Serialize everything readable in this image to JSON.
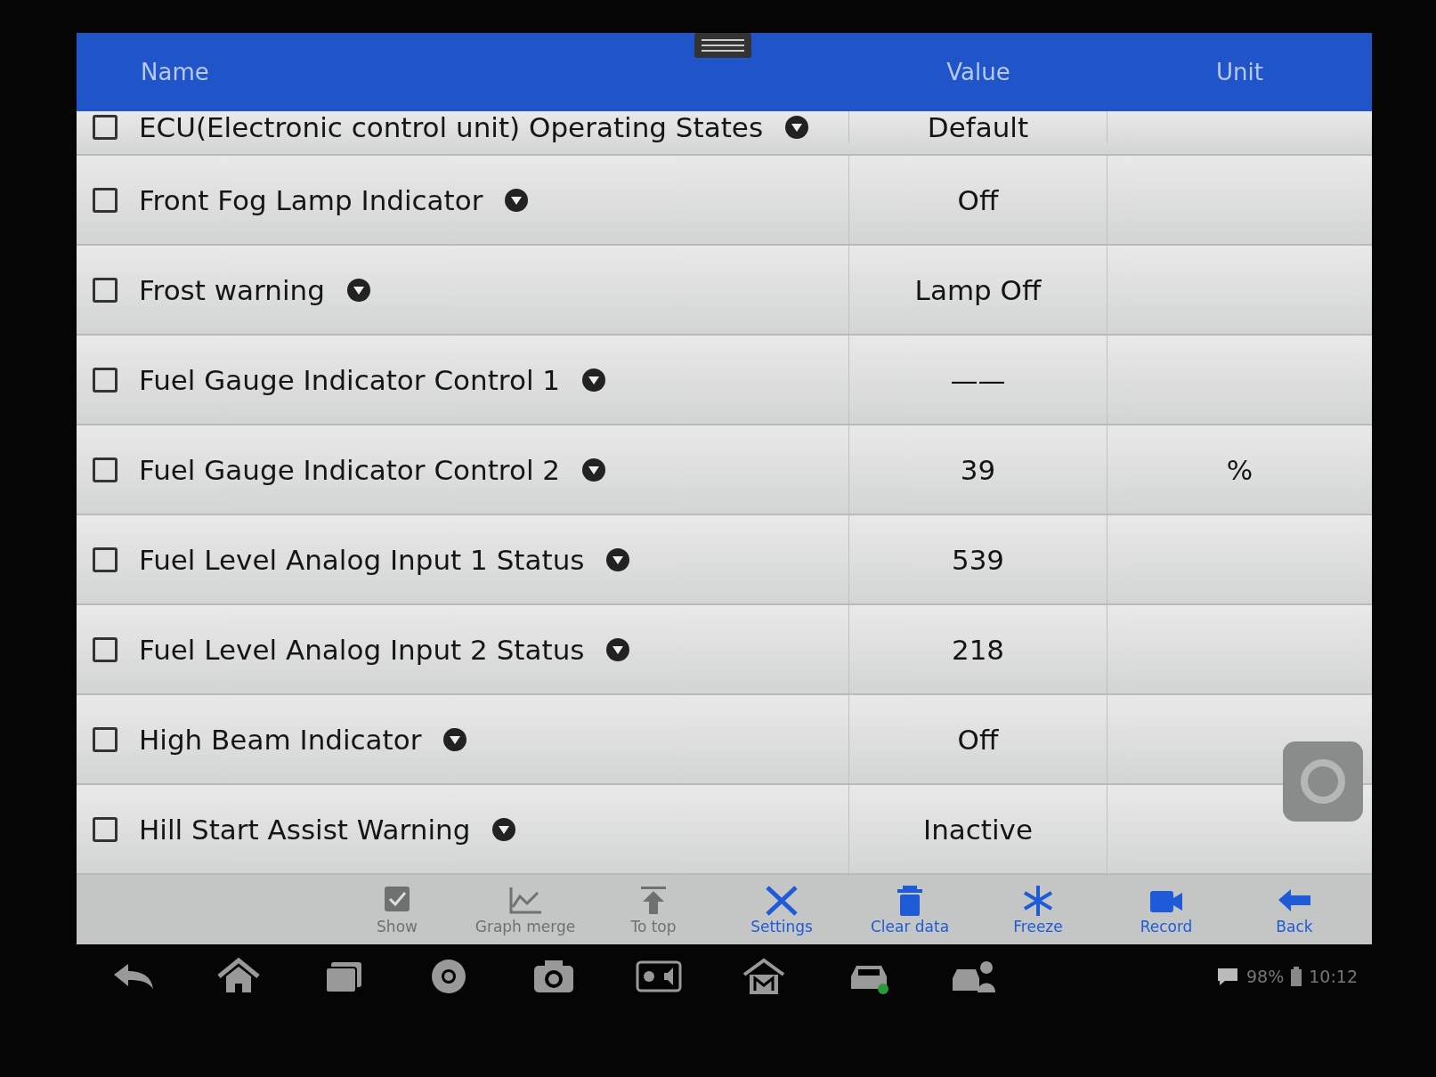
{
  "header": {
    "name": "Name",
    "value": "Value",
    "unit": "Unit"
  },
  "rows": [
    {
      "name": "ECU(Electronic control unit) Operating States",
      "value": "Default",
      "unit": "",
      "checked": false,
      "kind": "partial"
    },
    {
      "name": "Front Fog Lamp Indicator",
      "value": "Off",
      "unit": "",
      "checked": false,
      "kind": "full"
    },
    {
      "name": "Frost warning",
      "value": "Lamp Off",
      "unit": "",
      "checked": false,
      "kind": "full"
    },
    {
      "name": "Fuel Gauge Indicator Control 1",
      "value": "——",
      "unit": "",
      "checked": false,
      "kind": "full"
    },
    {
      "name": "Fuel Gauge Indicator Control 2",
      "value": "39",
      "unit": "%",
      "checked": false,
      "kind": "full"
    },
    {
      "name": "Fuel Level Analog Input 1 Status",
      "value": "539",
      "unit": "",
      "checked": false,
      "kind": "full"
    },
    {
      "name": "Fuel Level Analog Input 2 Status",
      "value": "218",
      "unit": "",
      "checked": false,
      "kind": "full"
    },
    {
      "name": "High Beam Indicator",
      "value": "Off",
      "unit": "",
      "checked": false,
      "kind": "full"
    },
    {
      "name": "Hill Start Assist Warning",
      "value": "Inactive",
      "unit": "",
      "checked": false,
      "kind": "full"
    }
  ],
  "toolbar": [
    {
      "label": "Show",
      "kind": "show",
      "disabled": true
    },
    {
      "label": "Graph merge",
      "kind": "graph",
      "disabled": true
    },
    {
      "label": "To top",
      "kind": "totop",
      "disabled": true
    },
    {
      "label": "Settings",
      "kind": "settings",
      "disabled": false
    },
    {
      "label": "Clear data",
      "kind": "clear",
      "disabled": false
    },
    {
      "label": "Freeze",
      "kind": "freeze",
      "disabled": false
    },
    {
      "label": "Record",
      "kind": "record",
      "disabled": false
    },
    {
      "label": "Back",
      "kind": "back",
      "disabled": false
    }
  ],
  "status_bar": {
    "battery": "98%",
    "time": "10:12"
  }
}
